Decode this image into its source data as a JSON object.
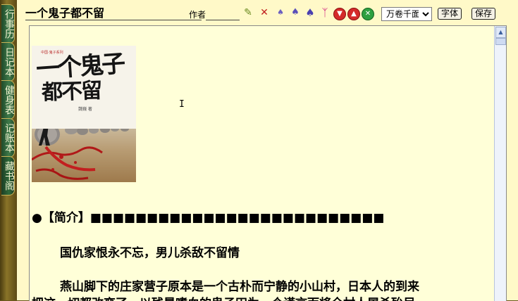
{
  "side_tabs": [
    {
      "label": "行事历"
    },
    {
      "label": "日记本"
    },
    {
      "label": "健身表"
    },
    {
      "label": "记账本"
    },
    {
      "label": "藏书阁"
    }
  ],
  "toolbar": {
    "title_value": "一个鬼子都不留",
    "author_label": "作者",
    "author_value": "",
    "volume_selected": "万卷千面",
    "font_button": "字体",
    "save_button": "保存",
    "icons": [
      "pencil-icon",
      "delete-icon",
      "spade-small-icon",
      "spade-medium-icon",
      "spade-large-icon",
      "bow-icon",
      "arrow-down-red-icon",
      "arrow-up-red-icon",
      "close-green-icon"
    ]
  },
  "cover": {
    "title_line1": "一个鬼子",
    "title_line2": "都不留",
    "brand": "中国·鬼子系列",
    "author": "魏巍 著"
  },
  "content": {
    "intro_heading": "●【简介】■■■■■■■■■■■■■■■■■■■■■■■■■■",
    "line1": "国仇家恨永不忘，男儿杀敌不留情",
    "line2": "燕山脚下的庄家营子原本是一个古朴而宁静的小山村，日本人的到来",
    "line3": "把这一切都改变了，以残暴嗜血的鬼子田为一个谎言而将全村人屠杀殆尽"
  },
  "colors": {
    "toolbar_bg": "#fff9c8",
    "editor_bg": "#ffffd8",
    "tab_green": "#2f6a3a",
    "frame_brown": "#6b5a1e"
  }
}
